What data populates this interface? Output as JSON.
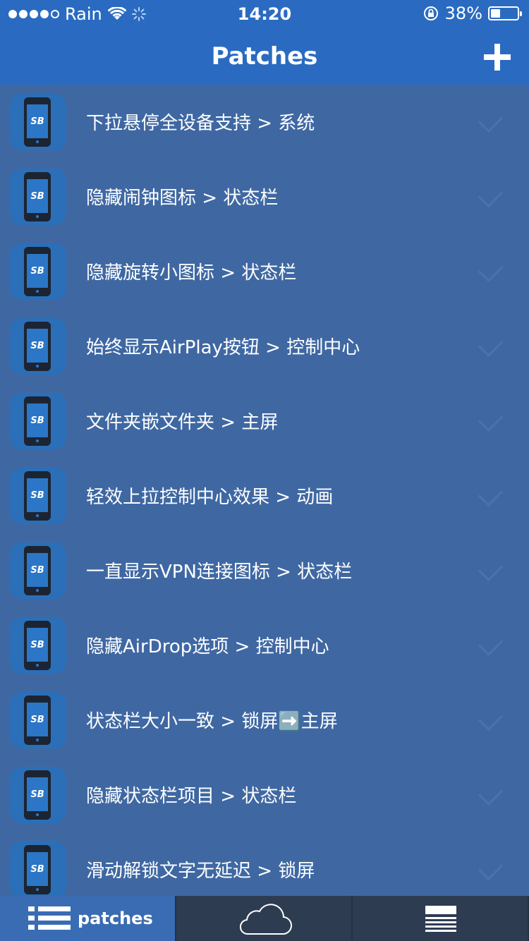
{
  "status_bar": {
    "carrier": "Rain",
    "time": "14:20",
    "battery_percent": "38%"
  },
  "nav": {
    "title": "Patches",
    "add_icon": "plus-icon"
  },
  "patches": [
    {
      "label": "下拉悬停全设备支持 > 系统",
      "icon_text": "SB"
    },
    {
      "label": "隐藏闹钟图标 > 状态栏",
      "icon_text": "SB"
    },
    {
      "label": "隐藏旋转小图标 > 状态栏",
      "icon_text": "SB"
    },
    {
      "label": "始终显示AirPlay按钮 > 控制中心",
      "icon_text": "SB"
    },
    {
      "label": "文件夹嵌文件夹 > 主屏",
      "icon_text": "SB"
    },
    {
      "label": "轻效上拉控制中心效果 > 动画",
      "icon_text": "SB"
    },
    {
      "label": "一直显示VPN连接图标 > 状态栏",
      "icon_text": "SB"
    },
    {
      "label": "隐藏AirDrop选项 > 控制中心",
      "icon_text": "SB"
    },
    {
      "label": "状态栏大小一致 > 锁屏➡️主屏",
      "icon_text": "SB"
    },
    {
      "label": "隐藏状态栏项目 > 状态栏",
      "icon_text": "SB"
    },
    {
      "label": "滑动解锁文字无延迟 > 锁屏",
      "icon_text": "SB"
    }
  ],
  "tabs": {
    "patches_label": "patches"
  },
  "colors": {
    "nav": "#2a6bc1",
    "list_bg": "#3f68a3",
    "tabbar": "#2e3c52",
    "tab_active": "#3a6cb3"
  }
}
